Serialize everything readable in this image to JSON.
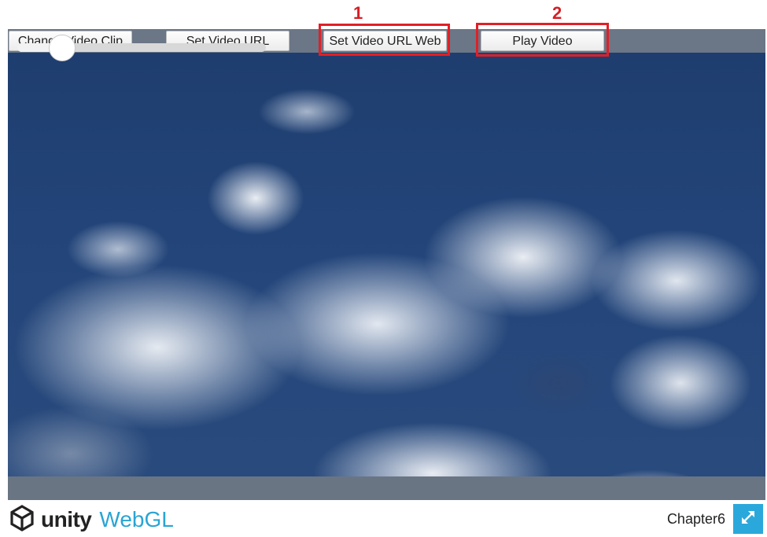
{
  "toolbar": {
    "change_clip_label": "Change Video Clip",
    "set_url_label": "Set Video URL",
    "set_url_web_label": "Set Video URL Web",
    "play_label": "Play Video"
  },
  "slider": {
    "value": 0.18
  },
  "annotations": {
    "step1": "1",
    "step2": "2",
    "color": "#e21f26"
  },
  "footer": {
    "unity": "unity",
    "webgl": "WebGL",
    "project_name": "Chapter6",
    "accent": "#2aa4d4"
  },
  "icons": {
    "logo": "unity-cube-icon",
    "fullscreen": "fullscreen-expand-icon"
  }
}
